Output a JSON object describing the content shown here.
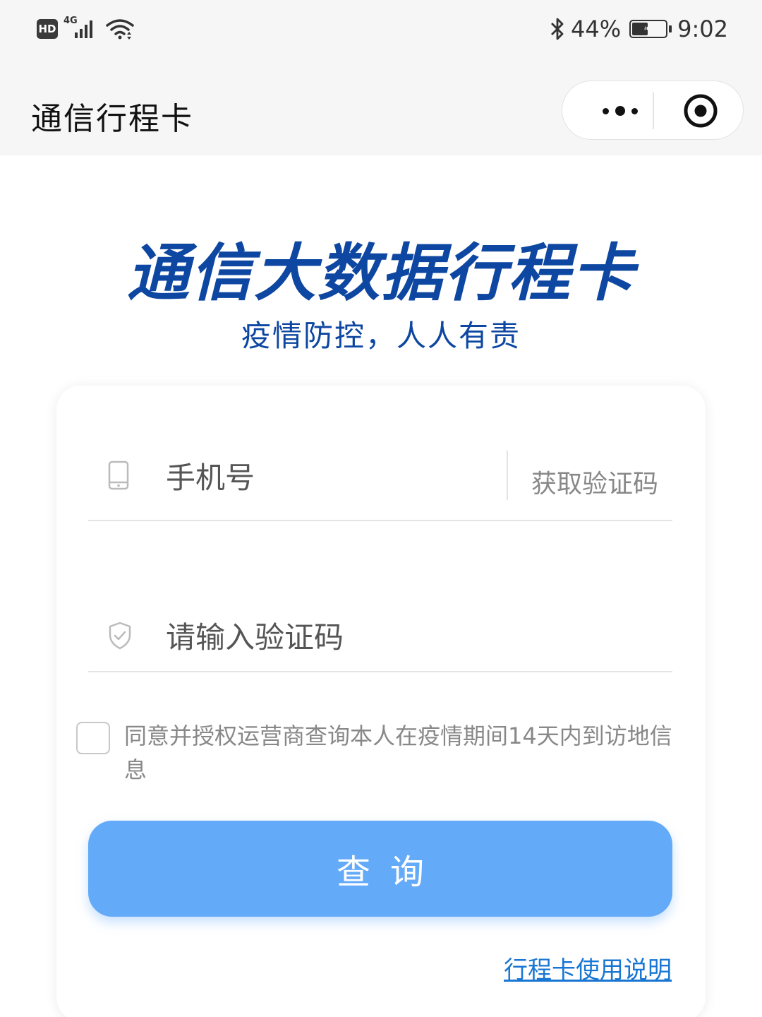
{
  "status_bar": {
    "hd_badge": "HD",
    "network": "4G",
    "battery_percent": "44%",
    "battery_level": 0.44,
    "time": "9:02",
    "icons": [
      "signal-icon",
      "wifi-icon",
      "bluetooth-icon",
      "battery-icon"
    ]
  },
  "header": {
    "title": "通信行程卡"
  },
  "hero": {
    "title": "通信大数据行程卡",
    "slogan": "疫情防控，人人有责"
  },
  "form": {
    "phone_placeholder": "手机号",
    "get_code_label": "获取验证码",
    "code_placeholder": "请输入验证码",
    "agreement_text": "同意并授权运营商查询本人在疫情期间14天内到访地信息",
    "agreement_checked": false,
    "submit_label": "查询",
    "help_link": "行程卡使用说明"
  },
  "colors": {
    "brand_blue": "#0d47a1",
    "button_blue": "#63aaf9",
    "link_blue": "#1976d2"
  }
}
